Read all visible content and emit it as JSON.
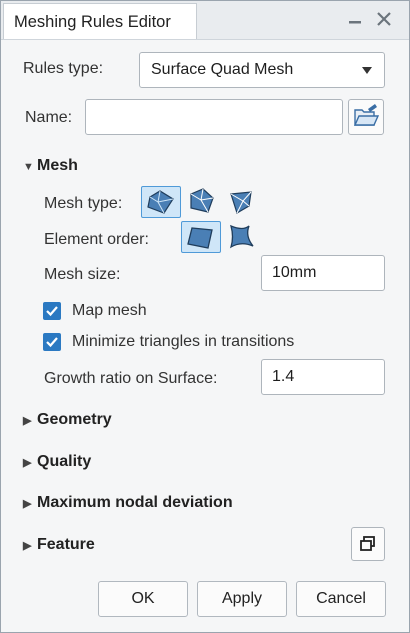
{
  "titlebar": {
    "title": "Meshing Rules Editor",
    "minimize_icon": "minimize-icon",
    "close_icon": "close-icon"
  },
  "form": {
    "rules_type_label": "Rules type:",
    "rules_type_value": "Surface Quad Mesh",
    "name_label": "Name:",
    "name_value": "",
    "folder_icon": "folder-open-icon"
  },
  "mesh": {
    "header": "Mesh",
    "mesh_type_label": "Mesh type:",
    "mesh_type_options": [
      "mesh-type-quad-icon",
      "mesh-type-mixed-icon",
      "mesh-type-tri-icon"
    ],
    "mesh_type_selected": 0,
    "element_order_label": "Element order:",
    "element_order_options": [
      "element-order-linear-icon",
      "element-order-quadratic-icon"
    ],
    "element_order_selected": 0,
    "mesh_size_label": "Mesh size:",
    "mesh_size_value": "10mm",
    "map_mesh_label": "Map mesh",
    "map_mesh_checked": true,
    "minimize_triangles_label": "Minimize triangles in transitions",
    "minimize_triangles_checked": true,
    "growth_ratio_label": "Growth ratio on Surface:",
    "growth_ratio_value": "1.4"
  },
  "sections": [
    "Geometry",
    "Quality",
    "Maximum nodal deviation",
    "Feature"
  ],
  "feature_icon": "restore-window-icon",
  "buttons": {
    "ok": "OK",
    "apply": "Apply",
    "cancel": "Cancel"
  },
  "colors": {
    "accent": "#2b79c2",
    "selected_bg": "#cfe6f8"
  }
}
